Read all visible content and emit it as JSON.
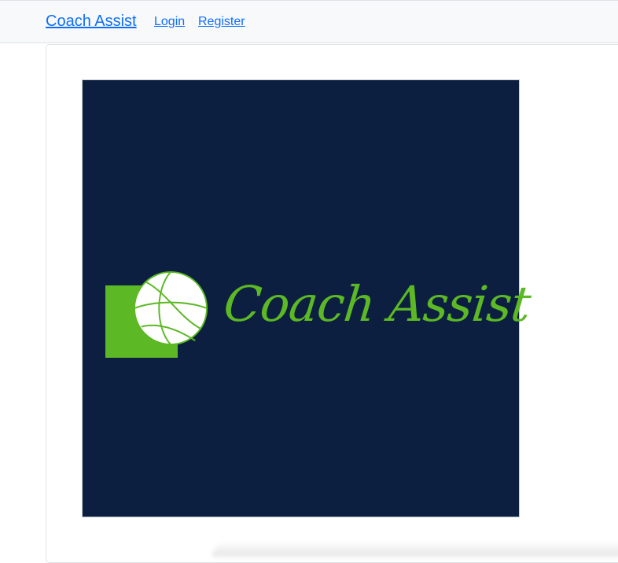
{
  "navbar": {
    "brand": "Coach Assist",
    "links": [
      {
        "label": "Login"
      },
      {
        "label": "Register"
      }
    ]
  },
  "logo": {
    "text": "Coach Assist",
    "colors": {
      "background": "#0c1f41",
      "accent": "#5cb824",
      "ball": "#ffffff"
    },
    "icon": "basketball-icon"
  },
  "colors": {
    "link": "#0d6efd",
    "navbar_bg": "#f8f9fa"
  }
}
